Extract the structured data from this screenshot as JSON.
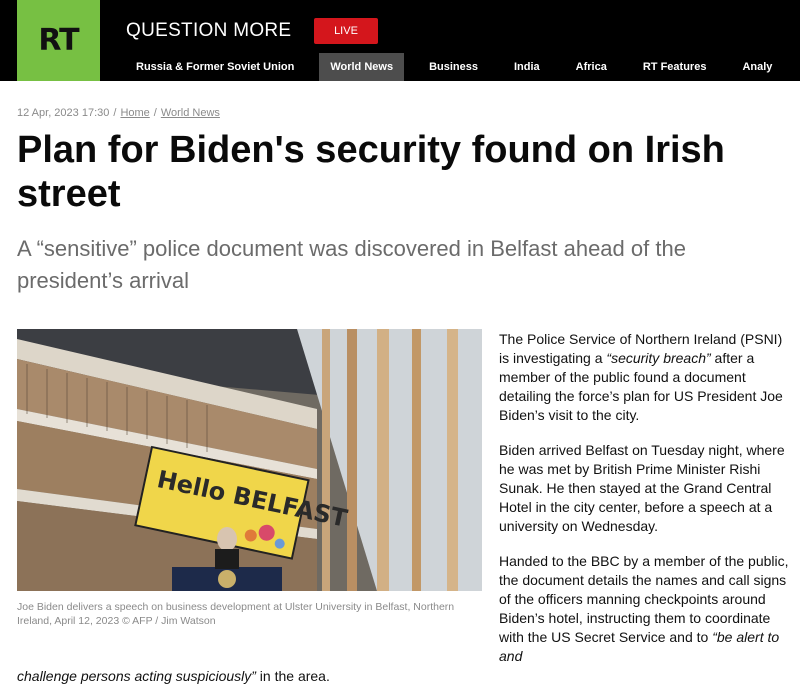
{
  "header": {
    "logo_text": "RT",
    "tagline": "QUESTION MORE",
    "live_label": "LIVE",
    "nav": [
      {
        "label": "Russia & Former Soviet Union"
      },
      {
        "label": "World News"
      },
      {
        "label": "Business"
      },
      {
        "label": "India"
      },
      {
        "label": "Africa"
      },
      {
        "label": "RT Features"
      },
      {
        "label": "Analy"
      }
    ],
    "brand_green": "#77c043",
    "live_red": "#d4161c"
  },
  "article": {
    "date": "12 Apr, 2023 17:30",
    "breadcrumb": [
      "Home",
      "World News"
    ],
    "title": "Plan for Biden's security found on Irish street",
    "subtitle": "A “sensitive” police document was discovered in Belfast ahead of the president’s arrival",
    "image_sign_text": "Hello BELFAST",
    "caption": "Joe Biden delivers a speech on business development at Ulster University in Belfast, Northern Ireland, April 12, 2023 ©  AFP / Jim Watson",
    "p1_a": "The Police Service of Northern Ireland (PSNI) is investigating a ",
    "p1_quote": "“security breach”",
    "p1_b": " after a member of the public found a document detailing the force’s plan for US President Joe Biden’s visit to the city.",
    "p2": "Biden arrived Belfast on Tuesday night, where he was met by British Prime Minister Rishi Sunak. He then stayed at the Grand Central Hotel in the city center, before a speech at a university on Wednesday.",
    "p3_a": "Handed to the BBC by a member of the public, the document details the names and call signs of the officers manning checkpoints around Biden’s hotel, instructing them to coordinate with the US Secret Service and to ",
    "p3_quote_start": "“be alert to and",
    "p3_quote_end": "challenge persons acting suspiciously”",
    "p3_end": " in the area."
  }
}
